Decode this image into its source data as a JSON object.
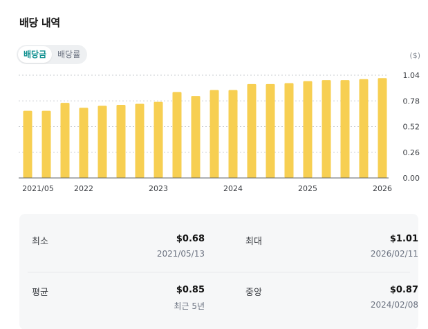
{
  "header": {
    "title": "배당 내역"
  },
  "toggle": {
    "options": [
      "배당금",
      "배당률"
    ],
    "active": 0
  },
  "unit_label": "($)",
  "chart_data": {
    "type": "bar",
    "x_tick_labels": [
      "2021/05",
      "2022",
      "2023",
      "2024",
      "2025",
      "2026"
    ],
    "x_tick_indices": [
      0,
      3,
      7,
      11,
      15,
      19
    ],
    "values": [
      0.68,
      0.68,
      0.76,
      0.71,
      0.73,
      0.74,
      0.75,
      0.77,
      0.87,
      0.83,
      0.89,
      0.89,
      0.95,
      0.95,
      0.96,
      0.98,
      0.99,
      0.99,
      1.0,
      1.01
    ],
    "y_ticks": [
      1.04,
      0.78,
      0.52,
      0.26,
      0.0
    ],
    "y_tick_labels": [
      "1.04",
      "0.78",
      "0.52",
      "0.26",
      "0.00"
    ],
    "ylim": [
      0,
      1.04
    ],
    "grid": true,
    "bar_color": "#f7cf52",
    "title": "",
    "xlabel": "",
    "ylabel": ""
  },
  "stats": {
    "min": {
      "label": "최소",
      "value": "$0.68",
      "sub": "2021/05/13"
    },
    "max": {
      "label": "최대",
      "value": "$1.01",
      "sub": "2026/02/11"
    },
    "avg": {
      "label": "평균",
      "value": "$0.85",
      "sub": "최근 5년"
    },
    "median": {
      "label": "중앙",
      "value": "$0.87",
      "sub": "2024/02/08"
    }
  }
}
